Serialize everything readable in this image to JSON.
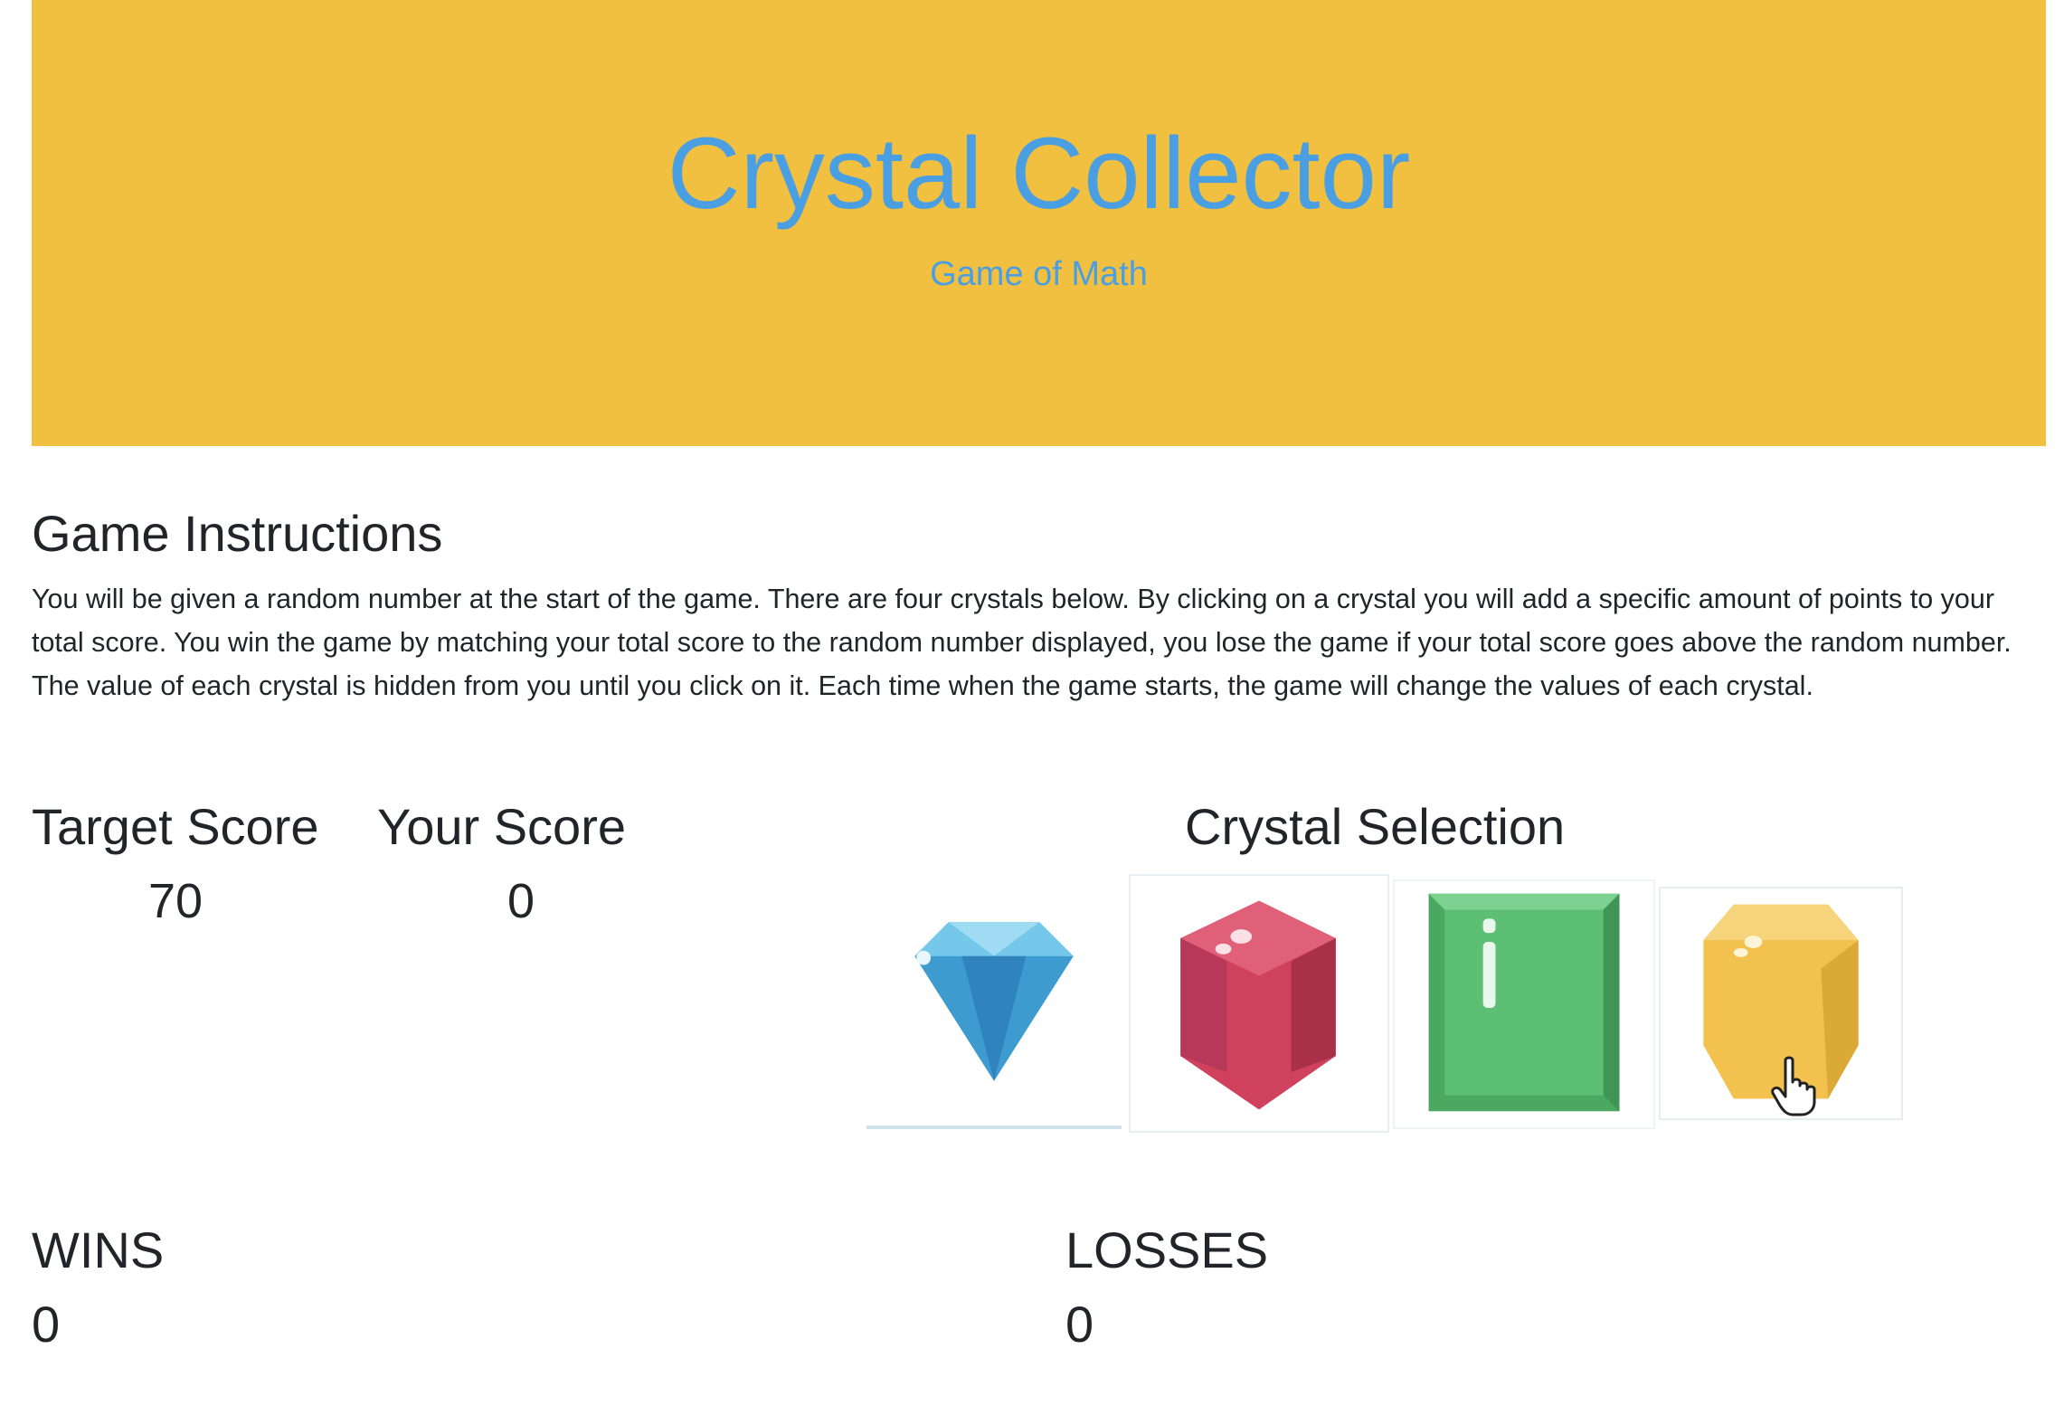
{
  "header": {
    "title": "Crystal Collector",
    "subtitle": "Game of Math"
  },
  "instructions": {
    "heading": "Game Instructions",
    "text": "You will be given a random number at the start of the game. There are four crystals below. By clicking on a crystal you will add a specific amount of points to your total score. You win the game by matching your total score to the random number displayed, you lose the game if your total score goes above the random number. The value of each crystal is hidden from you until you click on it. Each time when the game starts, the game will change the values of each crystal."
  },
  "scores": {
    "target_label": "Target Score",
    "target_value": "70",
    "your_label": "Your Score",
    "your_value": "0"
  },
  "crystals": {
    "heading": "Crystal Selection",
    "items": [
      {
        "name": "blue-diamond-crystal",
        "color": "#4fb3e0"
      },
      {
        "name": "red-hexagon-crystal",
        "color": "#d0415e"
      },
      {
        "name": "green-square-crystal",
        "color": "#5abf6f"
      },
      {
        "name": "yellow-octagon-crystal",
        "color": "#f2c14e"
      }
    ]
  },
  "stats": {
    "wins_label": "WINS",
    "wins_value": "0",
    "losses_label": "LOSSES",
    "losses_value": "0"
  },
  "colors": {
    "header_bg": "#f2c041",
    "title": "#4a9fe2",
    "text": "#212529"
  }
}
